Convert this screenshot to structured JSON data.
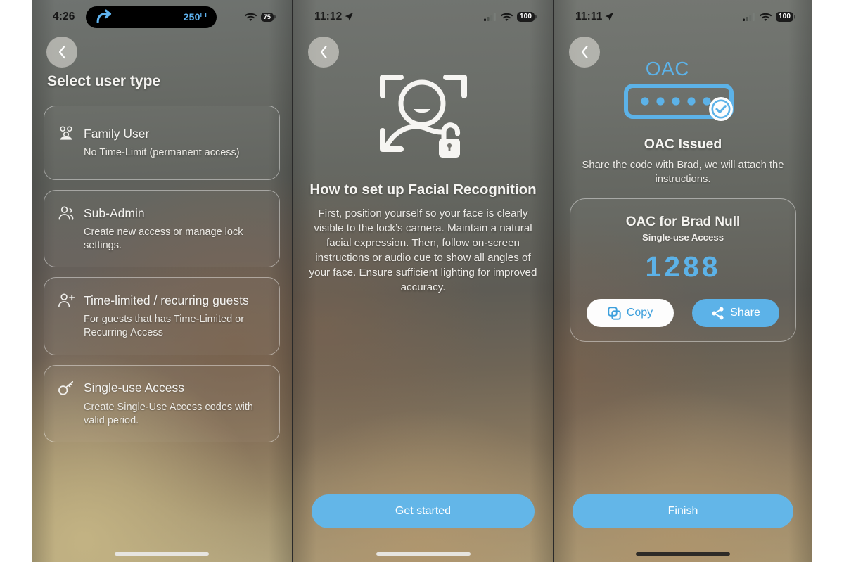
{
  "screens": [
    {
      "id": "select-user-type",
      "status": {
        "time": "4:26",
        "island_distance": "250",
        "island_distance_unit": "FT",
        "battery": "75",
        "icons": [
          "navigation-arrow-icon",
          "wifi-icon",
          "battery-icon"
        ]
      },
      "back_label": "Back",
      "title": "Select user type",
      "cards": [
        {
          "icon": "family-users-icon",
          "title": "Family User",
          "subtitle": "No Time-Limit (permanent access)"
        },
        {
          "icon": "sub-admin-user-icon",
          "title": "Sub-Admin",
          "subtitle": "Create new access or manage lock settings."
        },
        {
          "icon": "user-plus-icon",
          "title": "Time-limited / recurring guests",
          "subtitle": "For guests that has Time-Limited or Recurring Access"
        },
        {
          "icon": "key-icon",
          "title": "Single-use Access",
          "subtitle": "Create Single-Use Access codes with valid period."
        }
      ],
      "home_indicator": "light"
    },
    {
      "id": "facial-recognition-intro",
      "status": {
        "time": "11:12",
        "battery": "100",
        "icons": [
          "location-arrow-icon",
          "cellular-bars-icon",
          "wifi-icon",
          "battery-icon"
        ]
      },
      "back_label": "Back",
      "hero_icon": "face-scan-unlock-icon",
      "title": "How to set up Facial Recognition",
      "body": "First, position yourself so your face is clearly visible to the lock’s camera. Maintain a natural facial expression. Then, follow on-screen instructions or audio cue to show all angles of your face. Ensure sufficient lighting for improved accuracy.",
      "cta_label": "Get started",
      "home_indicator": "light"
    },
    {
      "id": "oac-issued",
      "status": {
        "time": "11:11",
        "battery": "100",
        "icons": [
          "location-arrow-icon",
          "cellular-bars-icon",
          "wifi-icon",
          "battery-icon"
        ]
      },
      "back_label": "Back",
      "hero_word": "OAC",
      "hero_icon": "passcode-field-check-icon",
      "title": "OAC Issued",
      "subtitle": "Share the code with Brad, we will attach the instructions.",
      "code_card": {
        "heading": "OAC for Brad Null",
        "kind": "Single-use Access",
        "code": "1288",
        "copy_label": "Copy",
        "copy_icon": "copy-icon",
        "share_label": "Share",
        "share_icon": "share-nodes-icon"
      },
      "cta_label": "Finish",
      "home_indicator": "dark"
    }
  ],
  "colors": {
    "accent_blue": "#5cb2e8",
    "cta_blue": "#63b6e8",
    "copy_text_blue": "#3c9fdc",
    "card_border": "rgba(255,255,255,0.42)",
    "text_primary": "#f4f3f0"
  }
}
